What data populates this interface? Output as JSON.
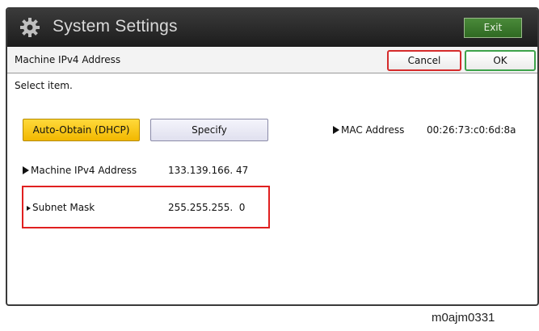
{
  "window": {
    "title": "System Settings",
    "exit_label": "Exit",
    "gear_icon": "gear-icon"
  },
  "subheader": {
    "title": "Machine IPv4 Address",
    "cancel_label": "Cancel",
    "ok_label": "OK"
  },
  "instruction": "Select item.",
  "mode_buttons": {
    "dhcp_label": "Auto-Obtain (DHCP)",
    "specify_label": "Specify",
    "selected": "Auto-Obtain (DHCP)"
  },
  "info": {
    "mac_label": "MAC Address",
    "mac_value": "00:26:73:c0:6d:8a",
    "ip_label": "Machine IPv4 Address",
    "ip_value": "133.139.166. 47",
    "mask_label": "Subnet Mask",
    "mask_value": "255.255.255.  0"
  },
  "caption": "m0ajm0331",
  "colors": {
    "titlebar": "#2b2b2b",
    "exit_button": "#3d7a2e",
    "cancel_border": "#d52b2b",
    "ok_border": "#3da24a",
    "selected_button": "#f7c41a",
    "highlight": "#e02020"
  }
}
